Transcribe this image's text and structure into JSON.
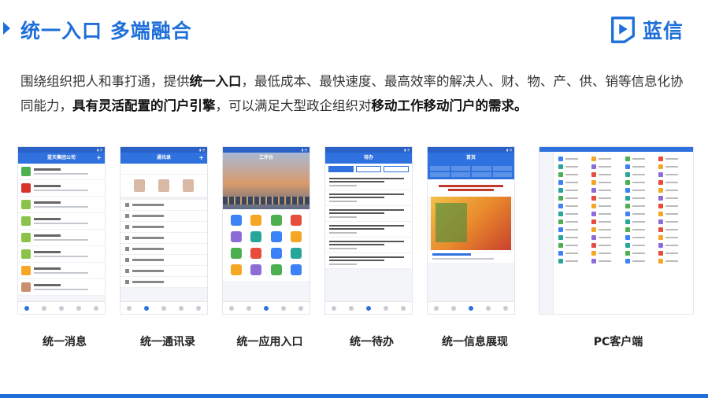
{
  "header": {
    "title": "统一入口 多端融合",
    "brand_name": "蓝信"
  },
  "description": {
    "part1": "围绕组织把人和事打通，提供",
    "bold1": "统一入口",
    "part2": "，最低成本、最快速度、最高效率的解决人、财、物、产、供、销等信息化协同能力，",
    "bold2": "具有灵活配置的门户引擎",
    "part3": "，可以满足大型政企组织对",
    "bold3": "移动工作移动门户的需求。"
  },
  "screens": {
    "message_title": "蓝天集团公司",
    "contacts_title": "通讯录",
    "apps_title": "工作台",
    "todo_title": "待办",
    "info_title": "首页"
  },
  "captions": [
    "统一消息",
    "统一通讯录",
    "统一应用入口",
    "统一待办",
    "统一信息展现",
    "PC客户端"
  ],
  "colors": {
    "accent": "#1e6fd9",
    "nav_blue": "#2f72df"
  }
}
